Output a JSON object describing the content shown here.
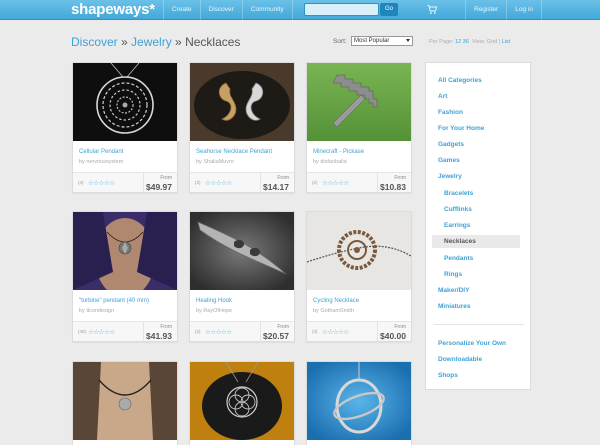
{
  "brand": {
    "logo_text": "shapeways*"
  },
  "nav": {
    "create": "Create",
    "discover": "Discover",
    "community": "Community",
    "register": "Register",
    "login": "Log in"
  },
  "search": {
    "value": "",
    "button_label": "Go"
  },
  "icons": {
    "cart": "cart-icon",
    "stars": "rating-stars-icon"
  },
  "breadcrumb": {
    "discover": "Discover",
    "sep1": " » ",
    "jewelry": "Jewelry",
    "sep2": " » ",
    "current": "Necklaces"
  },
  "sort": {
    "label": "Sort:",
    "selected": "Most Popular"
  },
  "perpage": {
    "label": "Per Page:",
    "opt1": "12",
    "opt2": "36",
    "view_label": "View:",
    "grid": "Grid",
    "sep": "|",
    "list": "List"
  },
  "products": [
    {
      "title": "Cellular Pendant",
      "by": "by nervoussystem",
      "count": "(4)",
      "stars": "☆☆☆☆☆",
      "from": "From",
      "price": "$49.97"
    },
    {
      "title": "Seahorse Necklace Pendant",
      "by": "by ShaliaMuvro",
      "count": "(2)",
      "stars": "☆☆☆☆☆",
      "from": "From",
      "price": "$14.17"
    },
    {
      "title": "Minecraft - Pickase",
      "by": "by disfanbalia",
      "count": "(2)",
      "stars": "☆☆☆☆☆",
      "from": "From",
      "price": "$10.83"
    },
    {
      "title": "\"turbine\" pendant (40 mm)",
      "by": "by tlcondesign",
      "count": "(40)",
      "stars": "☆☆☆☆☆",
      "from": "From",
      "price": "$41.93"
    },
    {
      "title": "Healing Hook",
      "by": "by RayOfHope",
      "count": "(2)",
      "stars": "☆☆☆☆☆",
      "from": "From",
      "price": "$20.57"
    },
    {
      "title": "Cycling Necklace",
      "by": "by GothamSmith",
      "count": "(3)",
      "stars": "☆☆☆☆☆",
      "from": "From",
      "price": "$40.00"
    }
  ],
  "sidebar": {
    "all_categories": "All Categories",
    "art": "Art",
    "fashion": "Fashion",
    "for_your_home": "For Your Home",
    "gadgets": "Gadgets",
    "games": "Games",
    "jewelry": "Jewelry",
    "bracelets": "Bracelets",
    "cufflinks": "Cufflinks",
    "earrings": "Earrings",
    "necklaces": "Necklaces",
    "pendants": "Pendants",
    "rings": "Rings",
    "maker_diy": "Maker/DIY",
    "miniatures": "Miniatures",
    "personalize": "Personalize Your Own",
    "downloadable": "Downloadable",
    "shops": "Shops"
  },
  "colors": {
    "accent": "#3ea2d6",
    "topbar": "#4eb3e0",
    "background": "#ebebeb"
  }
}
